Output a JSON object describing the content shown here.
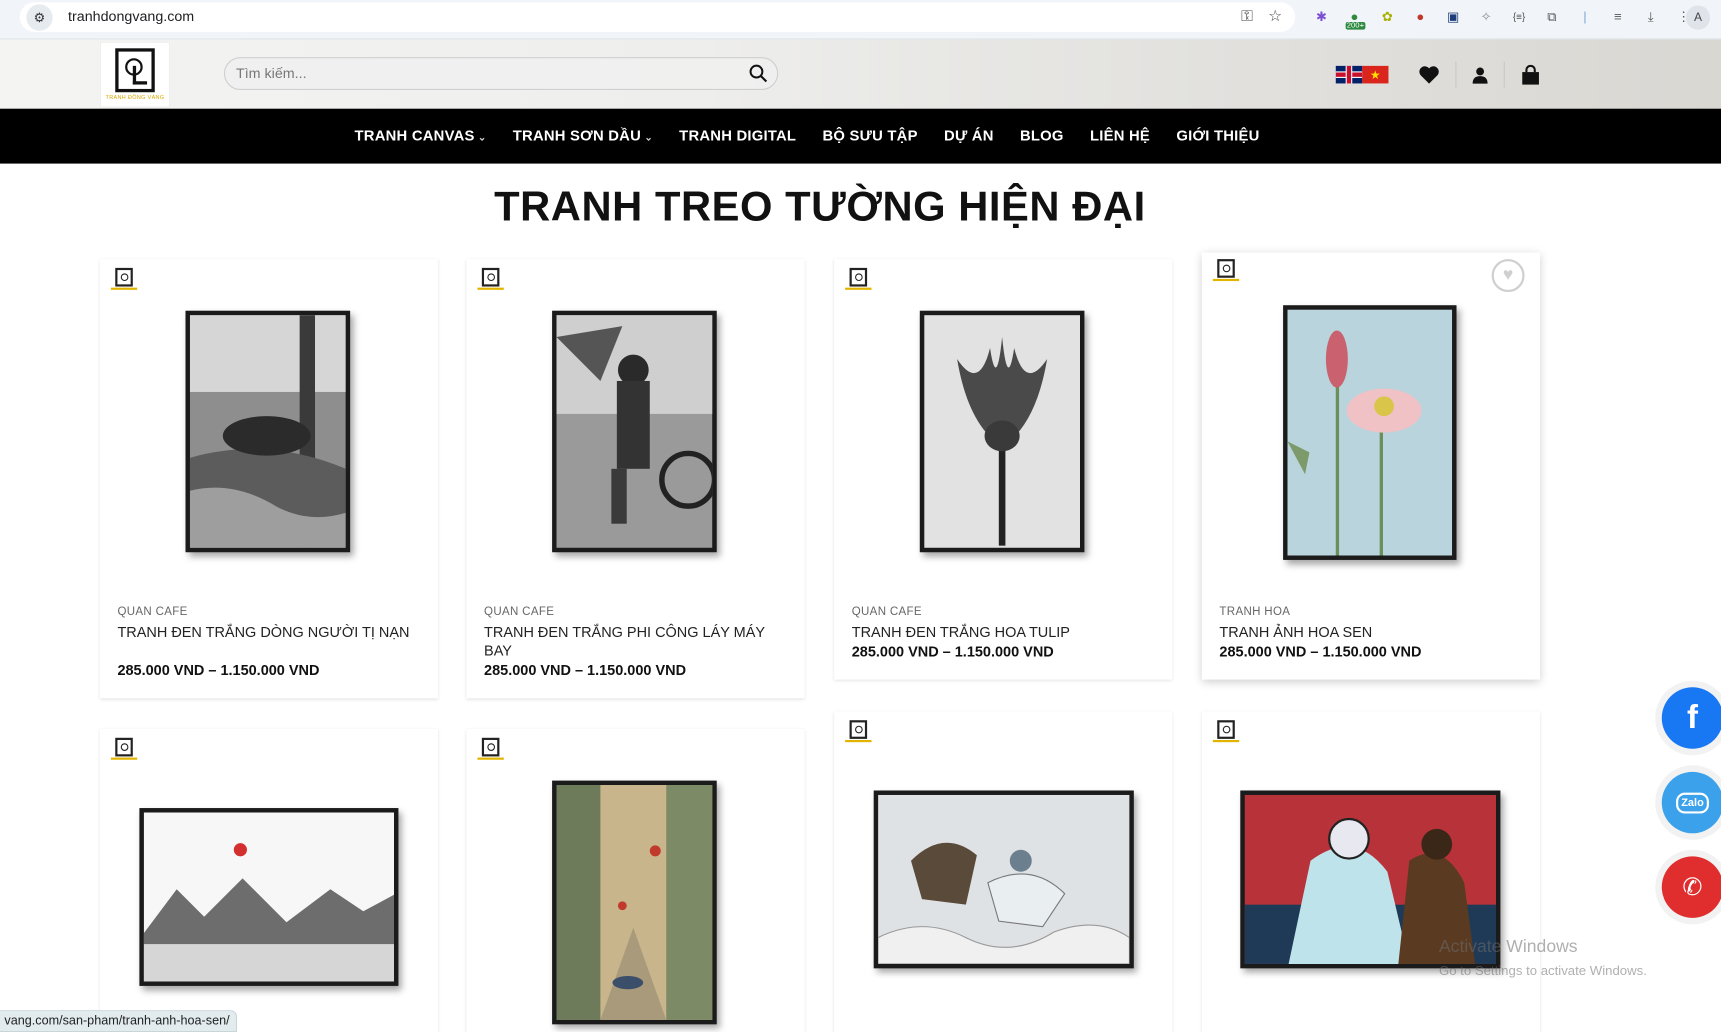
{
  "browser": {
    "url": "tranhdongvang.com",
    "profile_initial": "A",
    "ext_badge": "200+"
  },
  "header": {
    "logo_text": "TRANH ĐỒNG VÀNG",
    "search_placeholder": "Tìm kiếm..."
  },
  "nav": {
    "items": [
      {
        "label": "TRANH CANVAS",
        "has_dropdown": true
      },
      {
        "label": "TRANH SƠN DẦU",
        "has_dropdown": true
      },
      {
        "label": "TRANH DIGITAL",
        "has_dropdown": false
      },
      {
        "label": "BỘ SƯU TẬP",
        "has_dropdown": false
      },
      {
        "label": "DỰ ÁN",
        "has_dropdown": false
      },
      {
        "label": "BLOG",
        "has_dropdown": false
      },
      {
        "label": "LIÊN HỆ",
        "has_dropdown": false
      },
      {
        "label": "GIỚI THIỆU",
        "has_dropdown": false
      }
    ]
  },
  "page_title": "TRANH TREO TƯỜNG HIỆN ĐẠI",
  "products": [
    {
      "category": "QUAN CAFE",
      "name": "TRANH ĐEN TRẮNG DÒNG NGƯỜI TỊ NẠN",
      "price": "285.000 VND",
      "price_max": "1.150.000 VND"
    },
    {
      "category": "QUAN CAFE",
      "name": "TRANH ĐEN TRẮNG PHI CÔNG LÁY MÁY BAY",
      "price": "285.000 VND",
      "price_max": "1.150.000 VND"
    },
    {
      "category": "QUAN CAFE",
      "name": "TRANH ĐEN TRẮNG HOA TULIP",
      "price": "285.000 VND",
      "price_max": "1.150.000 VND"
    },
    {
      "category": "TRANH HOA",
      "name": "TRANH ẢNH HOA SEN",
      "price": "285.000 VND",
      "price_max": "1.150.000 VND"
    }
  ],
  "floating": {
    "zalo_label": "Zalo"
  },
  "watermark": {
    "line1": "Activate Windows",
    "line2": "Go to Settings to activate Windows."
  },
  "status_url": "vang.com/san-pham/tranh-anh-hoa-sen/",
  "colors": {
    "nav_bg": "#000000",
    "facebook": "#1877f2",
    "zalo": "#3aa1ea",
    "phone": "#e02d2d",
    "brand_gold": "#e2b400"
  }
}
